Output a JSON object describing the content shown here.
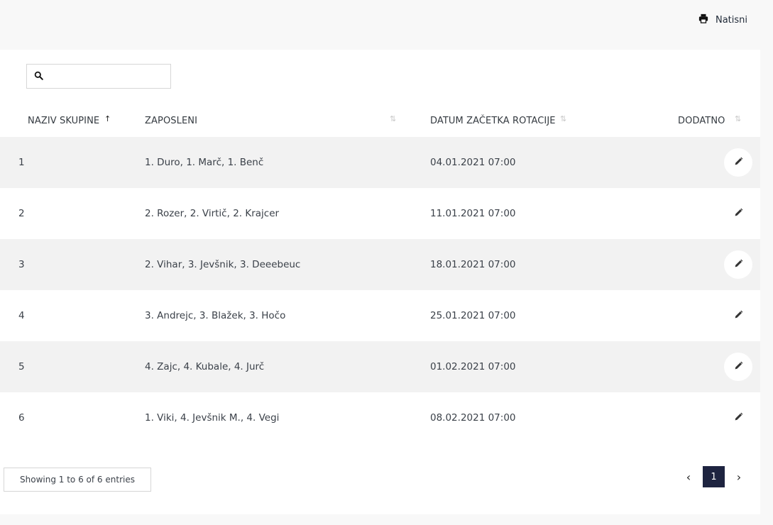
{
  "toolbar": {
    "print_label": "Natisni"
  },
  "search": {
    "value": "",
    "placeholder": ""
  },
  "table": {
    "headers": {
      "group": "NAZIV SKUPINE",
      "employees": "ZAPOSLENI",
      "start": "DATUM ZAČETKA ROTACIJE",
      "extra": "DODATNO"
    },
    "sort_icons": {
      "asc": "↑",
      "both": "⇅"
    },
    "rows": [
      {
        "group": "1",
        "employees": "1. Duro, 1. Marč, 1. Benč",
        "start": "04.01.2021 07:00"
      },
      {
        "group": "2",
        "employees": "2. Rozer, 2. Virtič, 2. Krajcer",
        "start": "11.01.2021 07:00"
      },
      {
        "group": "3",
        "employees": "2. Vihar, 3. Jevšnik, 3. Deeebeuc",
        "start": "18.01.2021 07:00"
      },
      {
        "group": "4",
        "employees": "3. Andrejc, 3. Blažek, 3. Hočo",
        "start": "25.01.2021 07:00"
      },
      {
        "group": "5",
        "employees": "4. Zajc, 4. Kubale, 4. Jurč",
        "start": "01.02.2021 07:00"
      },
      {
        "group": "6",
        "employees": "1. Viki, 4. Jevšnik M., 4. Vegi",
        "start": "08.02.2021 07:00"
      }
    ]
  },
  "footer": {
    "info": "Showing 1 to 6 of 6 entries",
    "prev": "‹",
    "page": "1",
    "next": "›"
  },
  "icons": {
    "print": "print-icon",
    "search": "search-icon",
    "edit": "pencil-icon",
    "sort": "sort-icon"
  },
  "colors": {
    "page_bg": "#f8f8f8",
    "row_alt": "#f2f2f2",
    "pager_active": "#1e2440"
  }
}
